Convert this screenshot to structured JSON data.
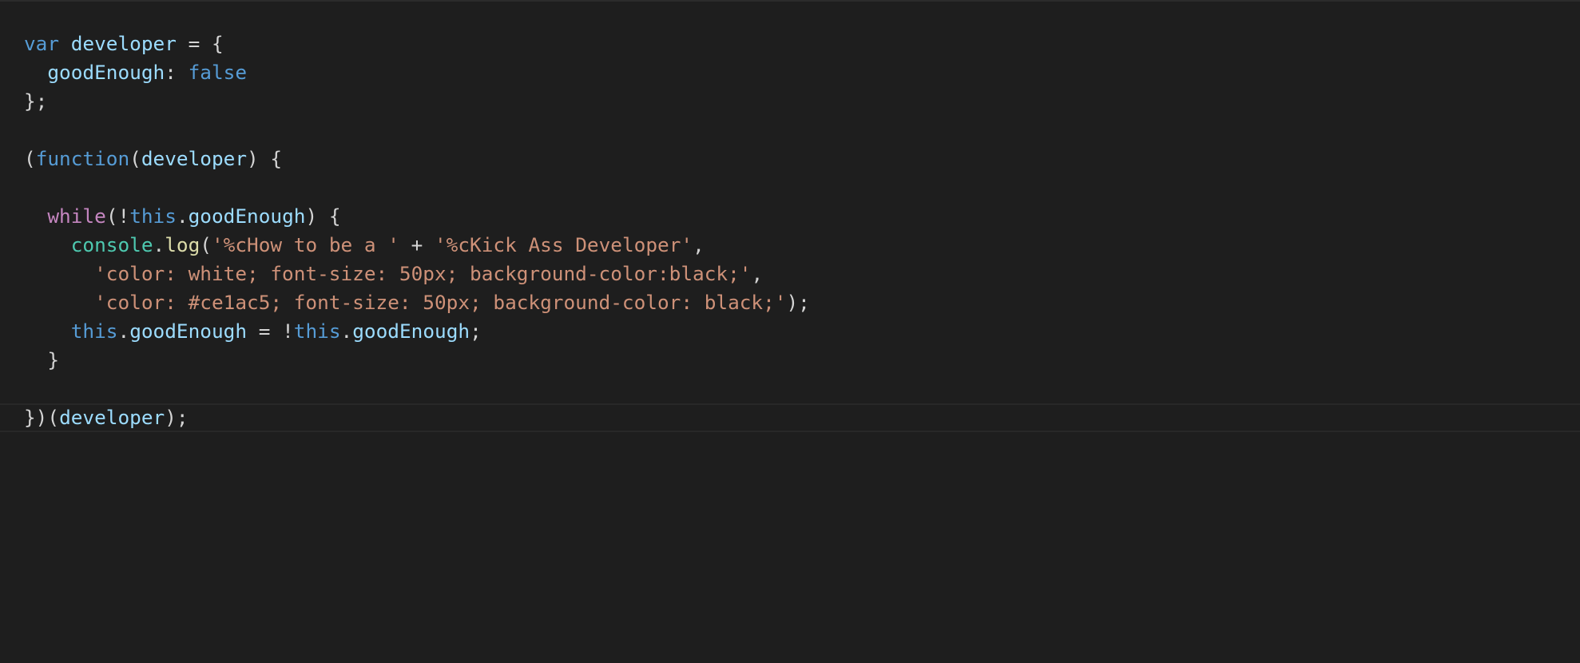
{
  "editor": {
    "colors": {
      "background": "#1e1e1e",
      "keyword": "#569cd6",
      "control": "#c586c0",
      "variable": "#9cdcfe",
      "object": "#4ec9b0",
      "function": "#dcdcaa",
      "string": "#ce9178",
      "punctuation": "#d4d4d4"
    },
    "current_line_index": 13,
    "lines": [
      {
        "tokens": [
          {
            "t": "var",
            "c": "kw"
          },
          {
            "t": " ",
            "c": "punc"
          },
          {
            "t": "developer",
            "c": "var"
          },
          {
            "t": " = {",
            "c": "punc"
          }
        ]
      },
      {
        "tokens": [
          {
            "t": "  ",
            "c": "punc"
          },
          {
            "t": "goodEnough",
            "c": "var"
          },
          {
            "t": ": ",
            "c": "punc"
          },
          {
            "t": "false",
            "c": "kw"
          }
        ]
      },
      {
        "tokens": [
          {
            "t": "};",
            "c": "punc"
          }
        ]
      },
      {
        "tokens": []
      },
      {
        "tokens": [
          {
            "t": "(",
            "c": "punc"
          },
          {
            "t": "function",
            "c": "kw"
          },
          {
            "t": "(",
            "c": "punc"
          },
          {
            "t": "developer",
            "c": "var"
          },
          {
            "t": ") {",
            "c": "punc"
          }
        ]
      },
      {
        "tokens": []
      },
      {
        "tokens": [
          {
            "t": "  ",
            "c": "punc"
          },
          {
            "t": "while",
            "c": "ctrl"
          },
          {
            "t": "(!",
            "c": "punc"
          },
          {
            "t": "this",
            "c": "kw"
          },
          {
            "t": ".",
            "c": "punc"
          },
          {
            "t": "goodEnough",
            "c": "var"
          },
          {
            "t": ") {",
            "c": "punc"
          }
        ]
      },
      {
        "tokens": [
          {
            "t": "    ",
            "c": "punc"
          },
          {
            "t": "console",
            "c": "obj"
          },
          {
            "t": ".",
            "c": "punc"
          },
          {
            "t": "log",
            "c": "fn"
          },
          {
            "t": "(",
            "c": "punc"
          },
          {
            "t": "'%cHow to be a '",
            "c": "str"
          },
          {
            "t": " + ",
            "c": "punc"
          },
          {
            "t": "'%cKick Ass Developer'",
            "c": "str"
          },
          {
            "t": ",",
            "c": "punc"
          }
        ]
      },
      {
        "tokens": [
          {
            "t": "      ",
            "c": "punc"
          },
          {
            "t": "'color: white; font-size: 50px; background-color:black;'",
            "c": "str"
          },
          {
            "t": ",",
            "c": "punc"
          }
        ]
      },
      {
        "tokens": [
          {
            "t": "      ",
            "c": "punc"
          },
          {
            "t": "'color: #ce1ac5; font-size: 50px; background-color: black;'",
            "c": "str"
          },
          {
            "t": ");",
            "c": "punc"
          }
        ]
      },
      {
        "tokens": [
          {
            "t": "    ",
            "c": "punc"
          },
          {
            "t": "this",
            "c": "kw"
          },
          {
            "t": ".",
            "c": "punc"
          },
          {
            "t": "goodEnough",
            "c": "var"
          },
          {
            "t": " = !",
            "c": "punc"
          },
          {
            "t": "this",
            "c": "kw"
          },
          {
            "t": ".",
            "c": "punc"
          },
          {
            "t": "goodEnough",
            "c": "var"
          },
          {
            "t": ";",
            "c": "punc"
          }
        ]
      },
      {
        "tokens": [
          {
            "t": "  }",
            "c": "punc"
          }
        ]
      },
      {
        "tokens": []
      },
      {
        "tokens": [
          {
            "t": "})(",
            "c": "punc"
          },
          {
            "t": "developer",
            "c": "var"
          },
          {
            "t": ");",
            "c": "punc"
          }
        ]
      }
    ]
  }
}
